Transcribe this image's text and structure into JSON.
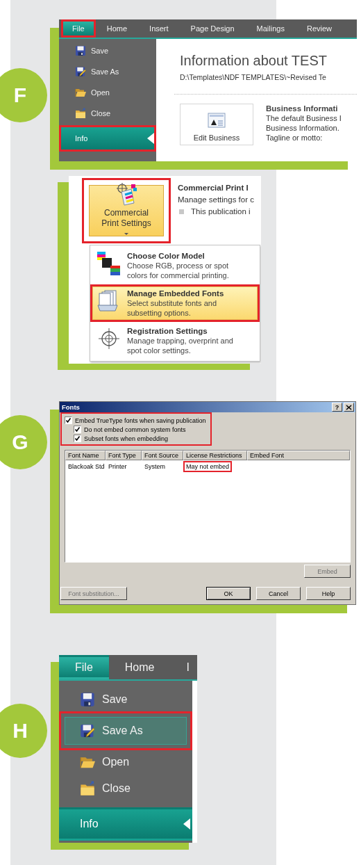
{
  "step_f": {
    "badge": "F",
    "tabs": [
      {
        "label": "File",
        "selected": true,
        "highlighted": true
      },
      {
        "label": "Home",
        "selected": false,
        "highlighted": false
      },
      {
        "label": "Insert",
        "selected": false,
        "highlighted": false
      },
      {
        "label": "Page Design",
        "selected": false,
        "highlighted": false
      },
      {
        "label": "Mailings",
        "selected": false,
        "highlighted": false
      },
      {
        "label": "Review",
        "selected": false,
        "highlighted": false
      }
    ],
    "menu": [
      {
        "kind": "save",
        "label": "Save",
        "selected": false,
        "highlighted": false
      },
      {
        "kind": "save_as",
        "label": "Save As",
        "selected": false,
        "highlighted": false
      },
      {
        "kind": "open",
        "label": "Open",
        "selected": false,
        "highlighted": false
      },
      {
        "kind": "close",
        "label": "Close",
        "selected": false,
        "highlighted": false
      },
      {
        "kind": "info",
        "label": "Info",
        "selected": true,
        "highlighted": true
      }
    ],
    "title": "Information about TEST",
    "path": "D:\\Templates\\NDF TEMPLATES\\~Revised Te",
    "edit_button": "Edit Business",
    "section_title": "Business Informati",
    "section_lines": [
      "The default Business I",
      "Business Information."
    ],
    "tagline_label": "Tagline or motto:"
  },
  "step_print": {
    "button": {
      "label": "Commercial Print Settings",
      "highlighted": true
    },
    "heading": "Commercial Print I",
    "description": "Manage settings for c",
    "bullet": "This publication i",
    "menu": [
      {
        "kind": "color_model",
        "title": "Choose Color Model",
        "description": "Choose RGB, process or spot colors for commercial printing.",
        "selected": false,
        "highlighted": false
      },
      {
        "kind": "fonts",
        "title": "Manage Embedded Fonts",
        "description": "Select substitute fonts and subsetting options.",
        "selected": true,
        "highlighted": true
      },
      {
        "kind": "registration",
        "title": "Registration Settings",
        "description": "Manage trapping, overprint and spot color settings.",
        "selected": false,
        "highlighted": false
      }
    ]
  },
  "step_g": {
    "badge": "G",
    "dialog": {
      "title": "Fonts",
      "help_button": "?",
      "options": {
        "highlighted": true,
        "items": [
          {
            "label": "Embed TrueType fonts when saving publication",
            "checked": true,
            "children": [
              {
                "label": "Do not embed common system fonts",
                "checked": true
              },
              {
                "label": "Subset fonts when embedding",
                "checked": true
              }
            ]
          }
        ]
      },
      "columns": [
        "Font Name",
        "Font Type",
        "Font Source",
        "License Restrictions",
        "Embed Font"
      ],
      "rows": [
        {
          "cells": [
            {
              "text": "Blackoak Std",
              "highlighted": false
            },
            {
              "text": "Printer",
              "highlighted": false
            },
            {
              "text": "System",
              "highlighted": false
            },
            {
              "text": "May not embed",
              "highlighted": true
            }
          ]
        }
      ],
      "embed_button": {
        "label": "Embed",
        "disabled": true
      },
      "substitution_button": {
        "label": "Font substitution...",
        "disabled": true
      },
      "buttons": [
        {
          "label": "OK",
          "default": true
        },
        {
          "label": "Cancel",
          "default": false
        },
        {
          "label": "Help",
          "default": false
        }
      ]
    }
  },
  "step_h": {
    "badge": "H",
    "tabs": [
      {
        "label": "File",
        "selected": true
      },
      {
        "label": "Home",
        "selected": false
      },
      {
        "label": "I",
        "selected": false
      }
    ],
    "menu": [
      {
        "kind": "save",
        "label": "Save",
        "selected": false,
        "hovered": false,
        "highlighted": false
      },
      {
        "kind": "save_as",
        "label": "Save As",
        "selected": false,
        "hovered": true,
        "highlighted": true
      },
      {
        "kind": "open",
        "label": "Open",
        "selected": false,
        "hovered": false,
        "highlighted": false
      },
      {
        "kind": "close",
        "label": "Close",
        "selected": false,
        "hovered": false,
        "highlighted": false
      },
      {
        "kind": "info",
        "label": "Info",
        "selected": true,
        "hovered": false,
        "highlighted": false
      }
    ]
  }
}
